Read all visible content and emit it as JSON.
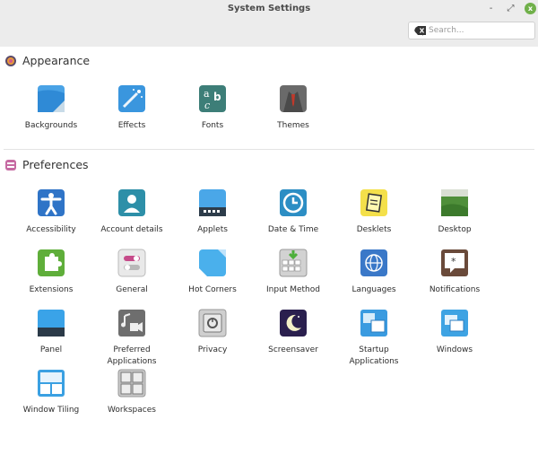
{
  "window": {
    "title": "System Settings",
    "minimize": "-",
    "maximize": "⤢",
    "close": "x"
  },
  "search": {
    "placeholder": "Search..."
  },
  "appearance": {
    "title": "Appearance",
    "items": [
      {
        "label": "Backgrounds",
        "icon": "backgrounds-icon"
      },
      {
        "label": "Effects",
        "icon": "effects-icon"
      },
      {
        "label": "Fonts",
        "icon": "fonts-icon"
      },
      {
        "label": "Themes",
        "icon": "themes-icon"
      }
    ]
  },
  "preferences": {
    "title": "Preferences",
    "items": [
      {
        "label": "Accessibility",
        "icon": "accessibility-icon"
      },
      {
        "label": "Account details",
        "icon": "account-icon"
      },
      {
        "label": "Applets",
        "icon": "applets-icon"
      },
      {
        "label": "Date & Time",
        "icon": "clock-icon"
      },
      {
        "label": "Desklets",
        "icon": "desklets-icon"
      },
      {
        "label": "Desktop",
        "icon": "desktop-icon"
      },
      {
        "label": "Extensions",
        "icon": "puzzle-icon"
      },
      {
        "label": "General",
        "icon": "toggles-icon"
      },
      {
        "label": "Hot Corners",
        "icon": "hot-corners-icon"
      },
      {
        "label": "Input Method",
        "icon": "keyboard-icon"
      },
      {
        "label": "Languages",
        "icon": "globe-icon"
      },
      {
        "label": "Notifications",
        "icon": "notification-icon"
      },
      {
        "label": "Panel",
        "icon": "panel-icon"
      },
      {
        "label": "Preferred\nApplications",
        "icon": "music-video-icon"
      },
      {
        "label": "Privacy",
        "icon": "safe-icon"
      },
      {
        "label": "Screensaver",
        "icon": "moon-icon"
      },
      {
        "label": "Startup\nApplications",
        "icon": "windows-icon"
      },
      {
        "label": "Windows",
        "icon": "windows-stack-icon"
      },
      {
        "label": "Window Tiling",
        "icon": "tiling-icon"
      },
      {
        "label": "Workspaces",
        "icon": "workspaces-icon"
      }
    ]
  },
  "colors": {
    "titlebar": "#ececec",
    "close": "#70b04a",
    "accent": "#3b8fd6"
  }
}
